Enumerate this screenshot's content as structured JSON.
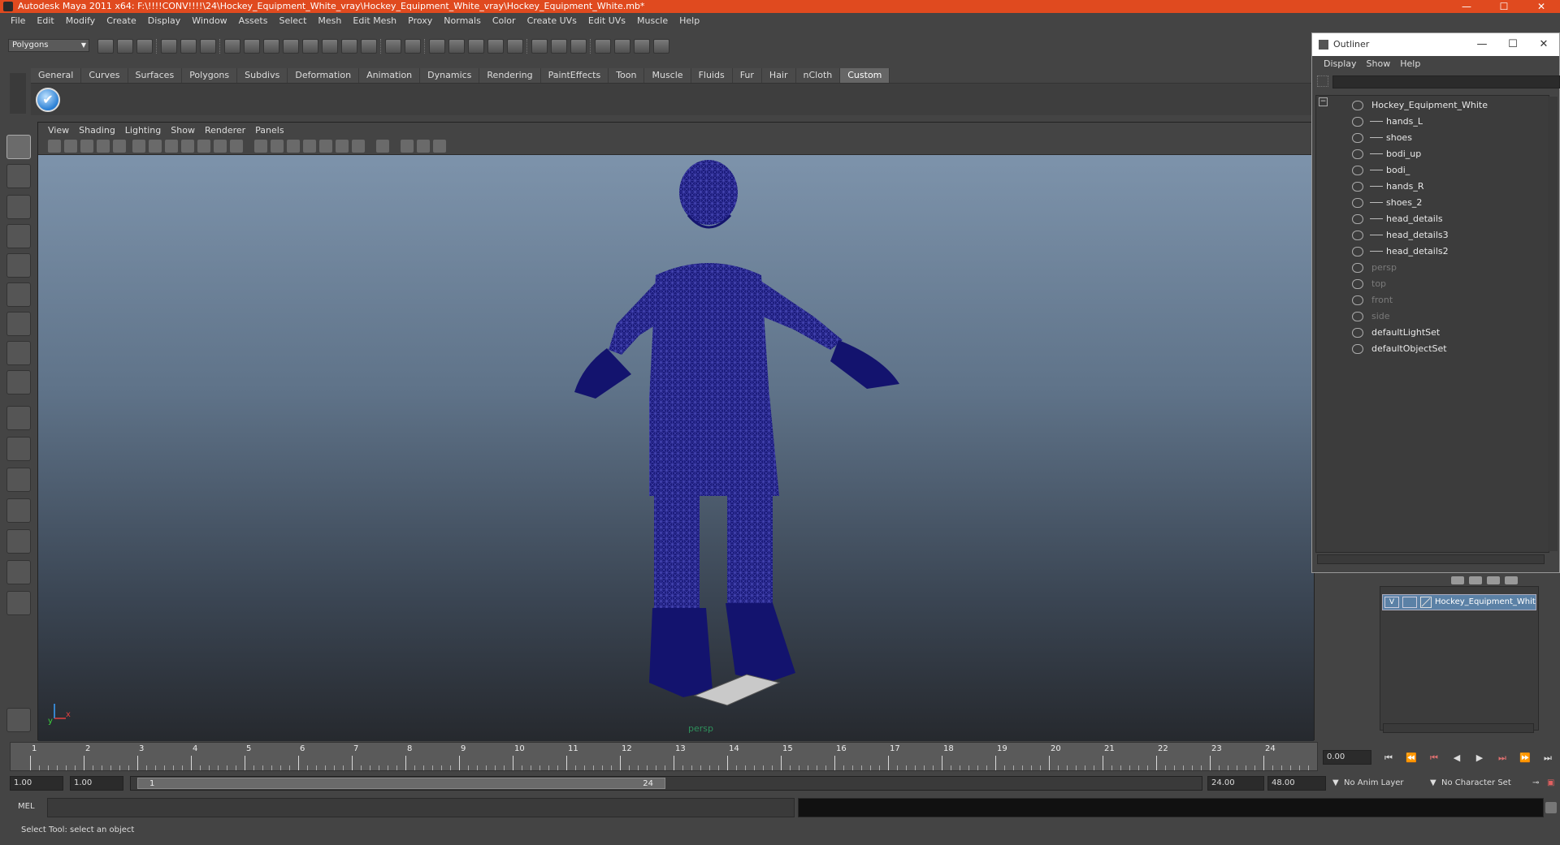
{
  "window": {
    "title": "Autodesk Maya 2011 x64: F:\\!!!!CONV!!!!\\24\\Hockey_Equipment_White_vray\\Hockey_Equipment_White_vray\\Hockey_Equipment_White.mb*",
    "minimize": "—",
    "maximize": "☐",
    "close": "✕"
  },
  "menubar": [
    "File",
    "Edit",
    "Modify",
    "Create",
    "Display",
    "Window",
    "Assets",
    "Select",
    "Mesh",
    "Edit Mesh",
    "Proxy",
    "Normals",
    "Color",
    "Create UVs",
    "Edit UVs",
    "Muscle",
    "Help"
  ],
  "mode_menu": "Polygons",
  "shelf_tabs": [
    "General",
    "Curves",
    "Surfaces",
    "Polygons",
    "Subdivs",
    "Deformation",
    "Animation",
    "Dynamics",
    "Rendering",
    "PaintEffects",
    "Toon",
    "Muscle",
    "Fluids",
    "Fur",
    "Hair",
    "nCloth",
    "Custom"
  ],
  "active_shelf_tab": "Custom",
  "panel_menu": [
    "View",
    "Shading",
    "Lighting",
    "Show",
    "Renderer",
    "Panels"
  ],
  "viewport": {
    "camera_label": "persp",
    "axis_y": "y",
    "axis_x": "x"
  },
  "outliner": {
    "title": "Outliner",
    "menu": [
      "Display",
      "Show",
      "Help"
    ],
    "items": [
      {
        "name": "Hockey_Equipment_White",
        "level": 0,
        "dim": false,
        "icon": "transform-icon"
      },
      {
        "name": "hands_L",
        "level": 1,
        "dim": false,
        "icon": "mesh-icon"
      },
      {
        "name": "shoes",
        "level": 1,
        "dim": false,
        "icon": "mesh-icon"
      },
      {
        "name": "bodi_up",
        "level": 1,
        "dim": false,
        "icon": "mesh-icon"
      },
      {
        "name": "bodi_",
        "level": 1,
        "dim": false,
        "icon": "mesh-icon"
      },
      {
        "name": "hands_R",
        "level": 1,
        "dim": false,
        "icon": "mesh-icon"
      },
      {
        "name": "shoes_2",
        "level": 1,
        "dim": false,
        "icon": "mesh-icon"
      },
      {
        "name": "head_details",
        "level": 1,
        "dim": false,
        "icon": "mesh-icon"
      },
      {
        "name": "head_details3",
        "level": 1,
        "dim": false,
        "icon": "mesh-icon"
      },
      {
        "name": "head_details2",
        "level": 1,
        "dim": false,
        "icon": "mesh-icon"
      },
      {
        "name": "persp",
        "level": 0,
        "dim": true,
        "icon": "camera-icon"
      },
      {
        "name": "top",
        "level": 0,
        "dim": true,
        "icon": "camera-icon"
      },
      {
        "name": "front",
        "level": 0,
        "dim": true,
        "icon": "camera-icon"
      },
      {
        "name": "side",
        "level": 0,
        "dim": true,
        "icon": "camera-icon"
      },
      {
        "name": "defaultLightSet",
        "level": 0,
        "dim": false,
        "icon": "set-icon"
      },
      {
        "name": "defaultObjectSet",
        "level": 0,
        "dim": false,
        "icon": "set-icon"
      }
    ]
  },
  "layer": {
    "visible_flag": "V",
    "name": "Hockey_Equipment_White"
  },
  "timeline": {
    "ticks": [
      1,
      2,
      3,
      4,
      5,
      6,
      7,
      8,
      9,
      10,
      11,
      12,
      13,
      14,
      15,
      16,
      17,
      18,
      19,
      20,
      21,
      22,
      23,
      24
    ],
    "current_time": "0.00"
  },
  "range": {
    "start": "1.00",
    "playback_start": "1.00",
    "slider_start": "1",
    "slider_end": "24",
    "playback_end": "24.00",
    "end": "48.00",
    "anim_layer": "No Anim Layer",
    "character_set": "No Character Set"
  },
  "command": {
    "label": "MEL"
  },
  "help_line": "Select Tool: select an object",
  "colors": {
    "title_bar": "#e04a1f",
    "wireframe": "#0b0b6e",
    "layer_highlight": "#5b81a6"
  }
}
